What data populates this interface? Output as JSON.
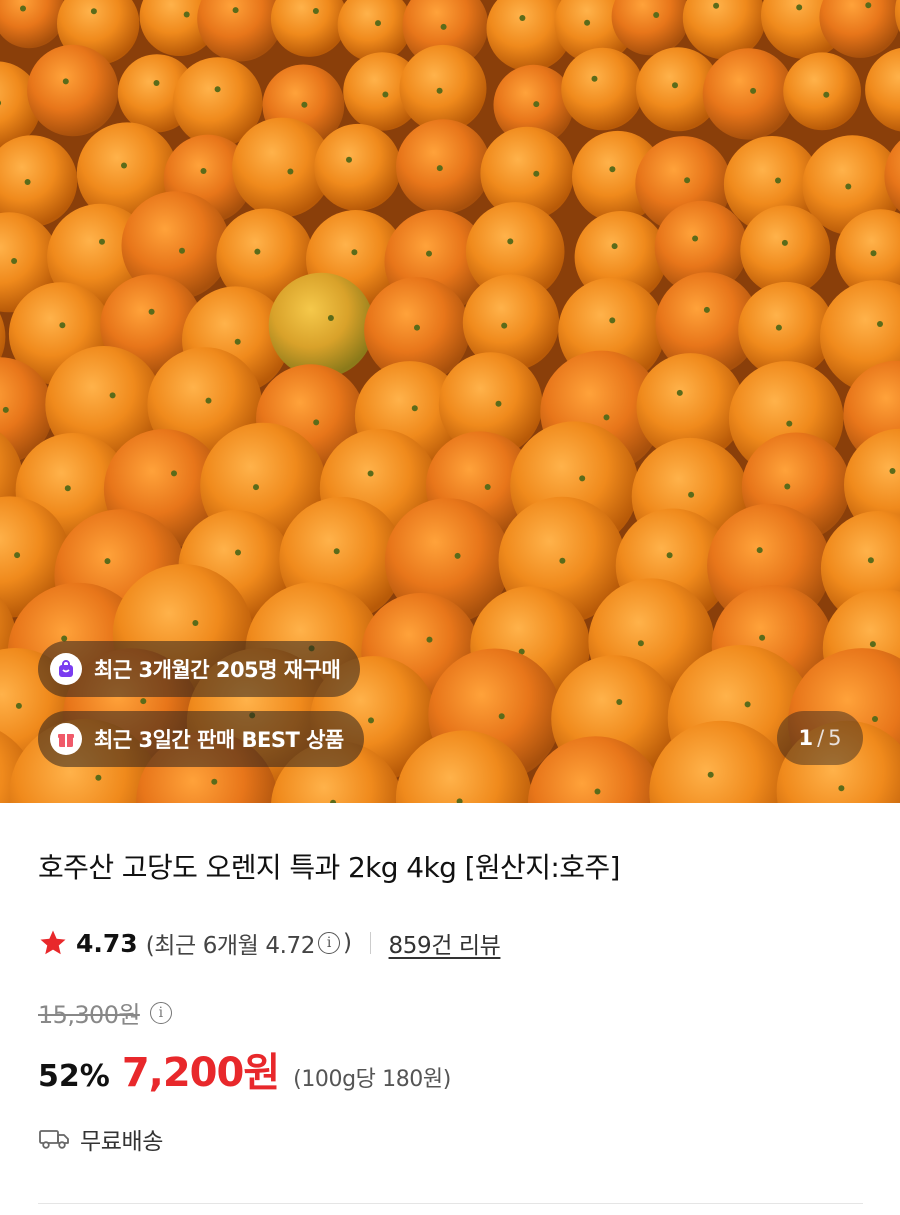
{
  "gallery": {
    "image_alt": "oranges-photo",
    "badges": [
      {
        "label": "최근 3개월간 205명 재구매",
        "icon": "repurchase-bag-icon"
      },
      {
        "label": "최근 3일간 판매 BEST 상품",
        "icon": "gift-box-icon"
      }
    ],
    "counter": {
      "current": "1",
      "separator": "/",
      "total": "5"
    }
  },
  "product": {
    "title": "호주산 고당도 오렌지 특과 2kg 4kg [원산지:호주]",
    "rating": {
      "value": "4.73",
      "recent_text": "(최근 6개월 4.72",
      "recent_close": ")",
      "info_glyph": "i",
      "review_count": "859건 리뷰"
    },
    "price": {
      "original": "15,300원",
      "info_glyph": "i",
      "discount": "52%",
      "sale": "7,200원",
      "unit": "(100g당 180원)"
    },
    "delivery": {
      "label": "무료배송",
      "icon": "truck-icon"
    }
  },
  "colors": {
    "accent_red": "#e8282b",
    "star": "#e8282b",
    "badge_purple": "#7a3cf0",
    "badge_red": "#f05a6a",
    "orange": "#f08a1c"
  }
}
